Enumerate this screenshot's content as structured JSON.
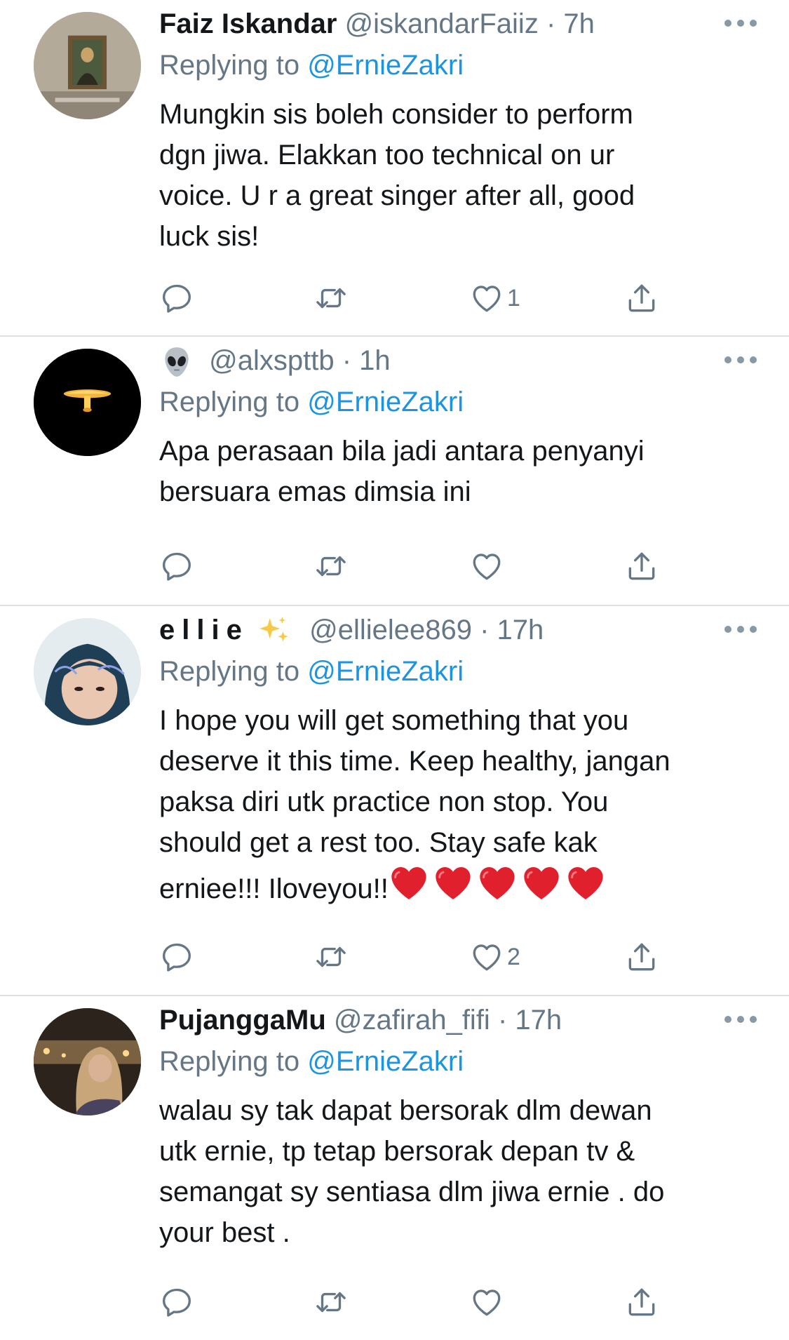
{
  "tweets": [
    {
      "name": "Faiz Iskandar",
      "handle": "@iskandarFaiiz",
      "separator": "·",
      "time": "7h",
      "replying_prefix": "Replying to ",
      "replying_to": "@ErnieZakri",
      "text": "Mungkin sis boleh consider to perform\ndgn jiwa. Elakkan too technical on ur\nvoice. U r a great singer after all, good\nluck sis!",
      "likes": "1",
      "avatar": "mona-lisa-photo"
    },
    {
      "name": "",
      "name_emoji": "alien-icon",
      "handle": "@alxspttb",
      "separator": "·",
      "time": "1h",
      "replying_prefix": "Replying to ",
      "replying_to": "@ErnieZakri",
      "text": "Apa perasaan bila jadi antara penyanyi\nbersuara emas dimsia ini",
      "likes": "",
      "avatar": "lamp-on-black"
    },
    {
      "name": "ellie",
      "name_emoji": "sparkles-icon",
      "handle": "@ellielee869",
      "separator": "·",
      "time": "17h",
      "replying_prefix": "Replying to ",
      "replying_to": "@ErnieZakri",
      "text": "I hope you will get something that you\ndeserve it this time. Keep healthy, jangan\npaksa diri utk practice non stop. You\nshould get a rest too. Stay safe kak\nerniee!!! Iloveyou!!",
      "text_emoji": "red-heart-icon x5",
      "likes": "2",
      "avatar": "hijab-selfie"
    },
    {
      "name": "PujanggaMu",
      "handle": "@zafirah_fifi",
      "separator": "·",
      "time": "17h",
      "replying_prefix": "Replying to ",
      "replying_to": "@ErnieZakri",
      "text": "walau sy tak dapat bersorak dlm dewan\nutk ernie, tp tetap bersorak depan tv &\nsemangat sy sentiasa dlm jiwa ernie . do\nyour best .",
      "likes": "",
      "avatar": "hijab-night-photo"
    }
  ],
  "colors": {
    "text": "#14171a",
    "secondary": "#657786",
    "link": "#1b95e0",
    "icon": "#657786",
    "divider": "#dcdfe3"
  }
}
